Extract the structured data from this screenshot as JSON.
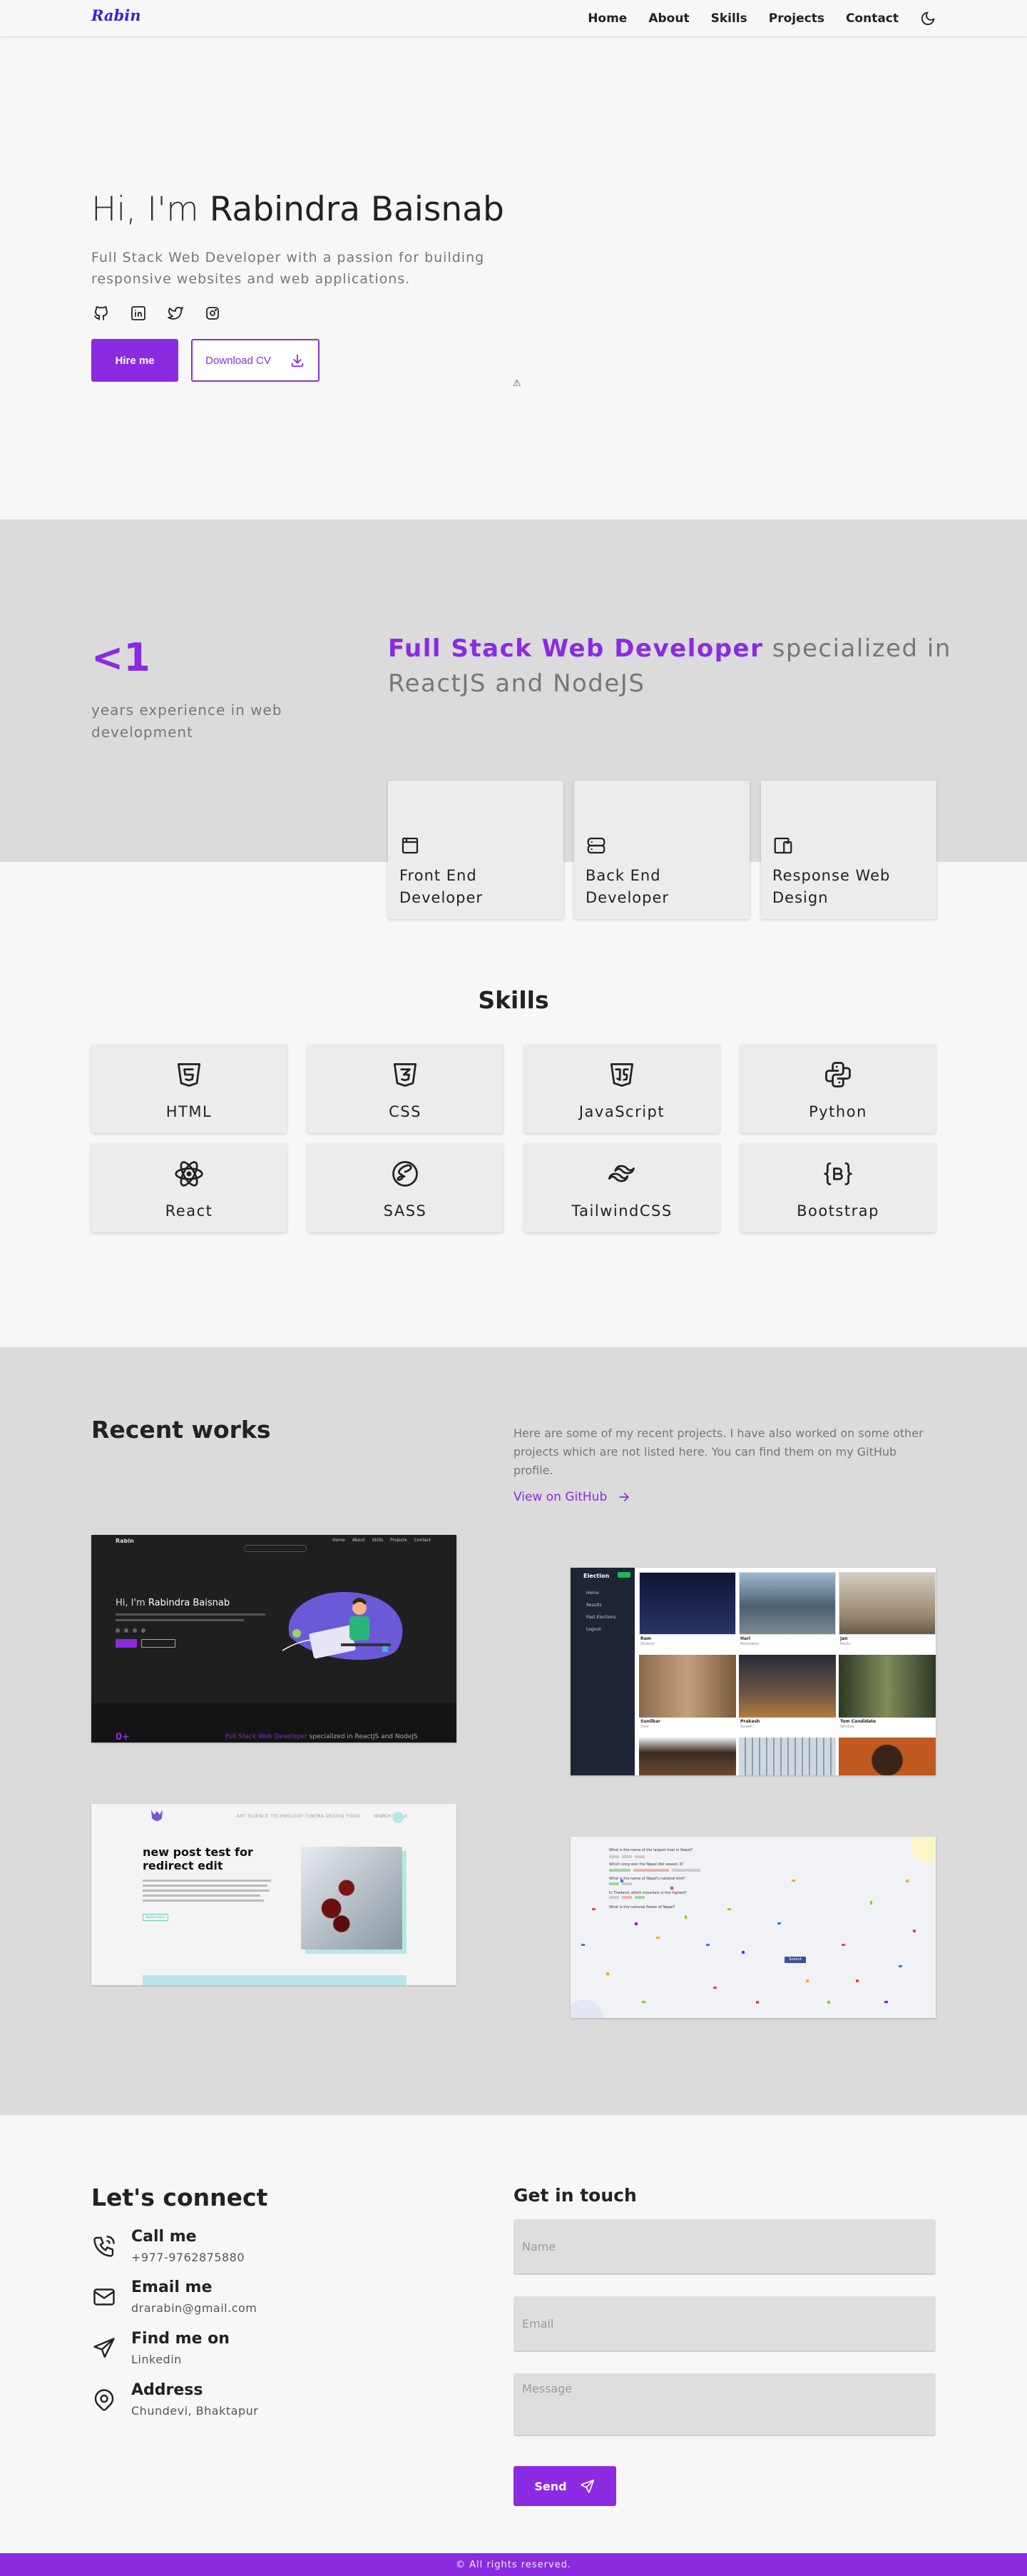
{
  "nav": {
    "logo": "Rabin",
    "links": [
      "Home",
      "About",
      "Skills",
      "Projects",
      "Contact"
    ],
    "theme_icon": "moon-icon"
  },
  "hero": {
    "greeting": "Hi, I'm",
    "name": "Rabindra Baisnab",
    "subtitle": "Full Stack Web Developer with a passion for building responsive websites and web applications.",
    "socials": [
      "github-icon",
      "linkedin-icon",
      "twitter-icon",
      "instagram-icon"
    ],
    "hire_label": "Hire me",
    "cv_label": "Download CV",
    "scroll_glyph": "⚠"
  },
  "about": {
    "experience_value": "<1",
    "experience_label": "years experience in web development",
    "headline_highlight": "Full Stack Web Developer",
    "headline_rest": " specialized in ReactJS and NodeJS",
    "services": [
      {
        "label": "Front End Developer",
        "icon": "browser-window-icon"
      },
      {
        "label": "Back End Developer",
        "icon": "server-icon"
      },
      {
        "label": "Response Web Design",
        "icon": "devices-icon"
      }
    ]
  },
  "skills": {
    "title": "Skills",
    "items": [
      {
        "label": "HTML",
        "icon": "html5-icon"
      },
      {
        "label": "CSS",
        "icon": "css3-icon"
      },
      {
        "label": "JavaScript",
        "icon": "javascript-icon"
      },
      {
        "label": "Python",
        "icon": "python-icon"
      },
      {
        "label": "React",
        "icon": "react-icon"
      },
      {
        "label": "SASS",
        "icon": "sass-icon"
      },
      {
        "label": "TailwindCSS",
        "icon": "tailwind-icon"
      },
      {
        "label": "Bootstrap",
        "icon": "bootstrap-icon"
      }
    ]
  },
  "works": {
    "title": "Recent works",
    "description": "Here are some of my recent projects. I have also worked on some other projects which are not listed here. You can find them on my GitHub profile.",
    "github_label": "View on GitHub",
    "thumb1": {
      "logo": "Rabin",
      "nav": [
        "Home",
        "About",
        "Skills",
        "Projects",
        "Contact"
      ],
      "greeting": "Hi, I'm",
      "name": "Rabindra Baisnab",
      "bottom_highlight": "Full Stack Web Developer",
      "bottom_rest": " specialized in ReactJS and NodeJS",
      "bottom_num": "0+"
    },
    "thumb2": {
      "brand": "Election",
      "menu": [
        "Home",
        "Results",
        "Past Elections",
        "Logout"
      ],
      "cards": [
        {
          "title": "Ram",
          "sub": "Student"
        },
        {
          "title": "Hari",
          "sub": "Mountains"
        },
        {
          "title": "Jan",
          "sub": "Rocks"
        },
        {
          "title": "Sunilkar",
          "sub": "Door"
        },
        {
          "title": "Prakash",
          "sub": "Sunset"
        },
        {
          "title": "Tom Candidate",
          "sub": "Window"
        }
      ]
    },
    "thumb3": {
      "nav": "ART SCIENCE TECHNOLOGY CINEMA DESIGN FOOD",
      "nav_right": "SEARCH Logout",
      "headline": "new post test for redirect edit",
      "button": "Read more"
    },
    "thumb4": {
      "questions": [
        "What is the name of the largest river in Nepal?",
        "Which song won the Nepal Idol season 3?",
        "What is the name of Nepal's national bird?",
        "In Thailand, which mountain is the highest?",
        "What is the national flower of Nepal?"
      ],
      "button": "Submit"
    }
  },
  "contact": {
    "title": "Let's connect",
    "items": [
      {
        "title": "Call me",
        "value": "+977-9762875880",
        "icon": "phone-icon"
      },
      {
        "title": "Email me",
        "value": "drarabin@gmail.com",
        "icon": "mail-icon"
      },
      {
        "title": "Find me on",
        "value": "Linkedin",
        "icon": "send-icon"
      },
      {
        "title": "Address",
        "value": "Chundevi, Bhaktapur",
        "icon": "map-pin-icon"
      }
    ],
    "form_title": "Get in touch",
    "name_placeholder": "Name",
    "email_placeholder": "Email",
    "message_placeholder": "Message",
    "send_label": "Send"
  },
  "footer": {
    "text": "© All rights reserved."
  },
  "colors": {
    "accent": "#8a2be2",
    "logo": "#3b23d8",
    "band": "#dbdbdb",
    "card": "#ececec"
  }
}
